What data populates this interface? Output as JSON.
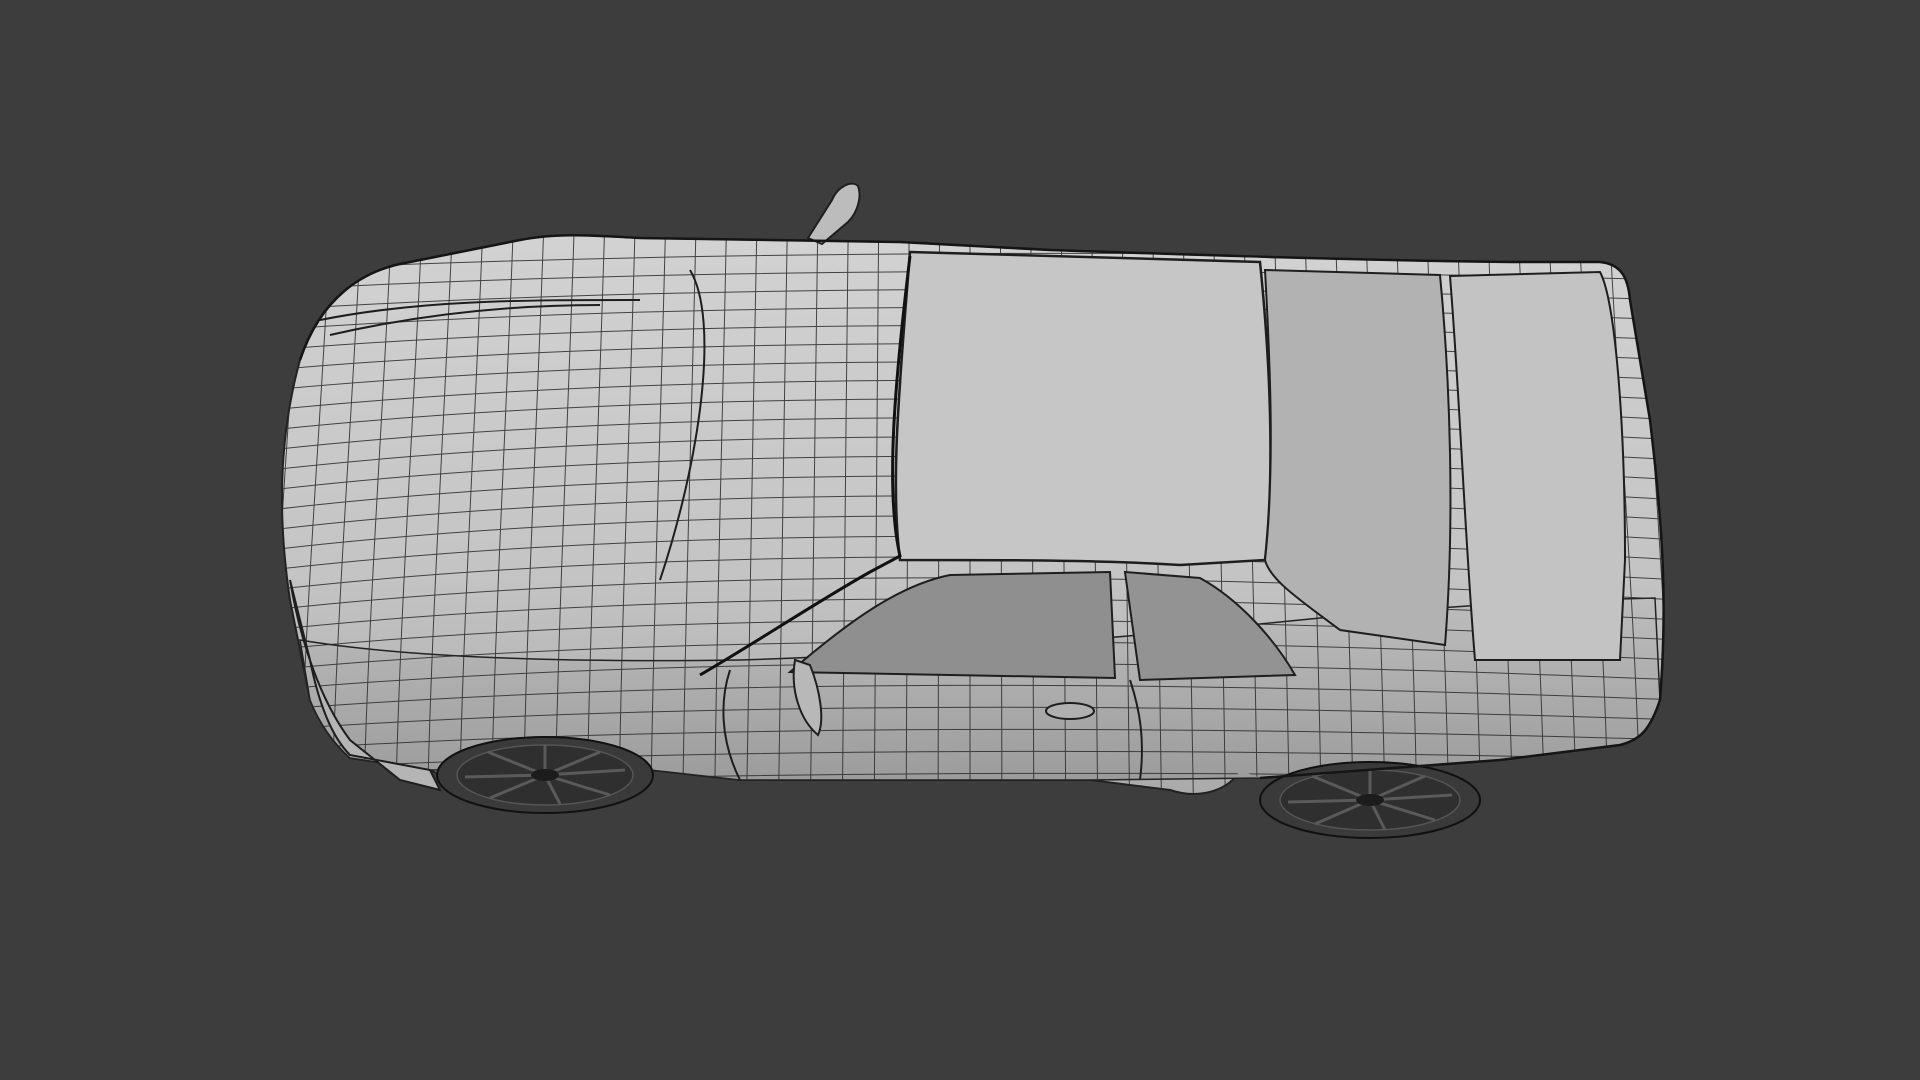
{
  "viewport": {
    "background_color": "#3d3d3d",
    "subject": "car-wireframe-render",
    "view": "top-perspective",
    "display_mode": "solid-with-wireframe"
  },
  "colors": {
    "body_fill": "#c9c9c9",
    "body_shadow": "#a8a8a8",
    "glass_fill": "#9a9a9a",
    "wire_color": "#2a2a2a",
    "wheel_fill": "#3a3a3a"
  }
}
